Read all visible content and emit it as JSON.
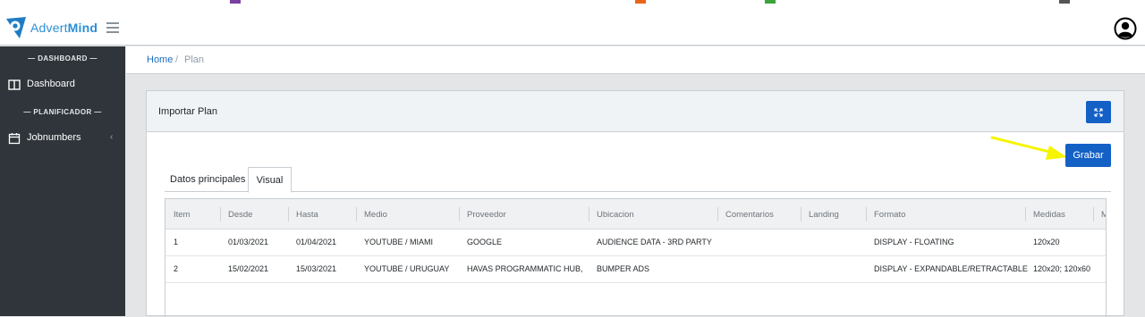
{
  "app": {
    "brand_light": "Advert",
    "brand_bold": "Mind",
    "brand_color": "#2a8fd6",
    "accent_color": "#1461c6",
    "sidebar_bg": "#2f353a"
  },
  "sidebar": {
    "section_dashboard": "DASHBOARD",
    "section_planificador": "PLANIFICADOR",
    "items": [
      {
        "label": "Dashboard",
        "icon": "columns-icon"
      },
      {
        "label": "Jobnumbers",
        "icon": "calendar-icon"
      }
    ]
  },
  "breadcrumb": {
    "home": "Home",
    "separator": "/",
    "current": "Plan"
  },
  "card": {
    "title": "Importar Plan",
    "save_label": "Grabar",
    "expand_icon": "expand-icon"
  },
  "tabs": [
    {
      "label": "Datos principales",
      "active": false
    },
    {
      "label": "Visual",
      "active": true
    }
  ],
  "table": {
    "columns": [
      "Item",
      "Desde",
      "Hasta",
      "Medio",
      "Proveedor",
      "Ubicacion",
      "Comentarios",
      "Landing",
      "Formato",
      "Medidas",
      "M"
    ],
    "rows": [
      [
        "1",
        "01/03/2021",
        "01/04/2021",
        "YOUTUBE / MIAMI",
        "GOOGLE",
        "AUDIENCE DATA - 3RD PARTY",
        "",
        "",
        "DISPLAY - FLOATING",
        "120x20",
        ""
      ],
      [
        "2",
        "15/02/2021",
        "15/03/2021",
        "YOUTUBE / URUGUAY",
        "HAVAS PROGRAMMATIC HUB,",
        "BUMPER ADS",
        "",
        "",
        "DISPLAY - EXPANDABLE/RETRACTABLE",
        "120x20; 120x60",
        ""
      ]
    ]
  }
}
